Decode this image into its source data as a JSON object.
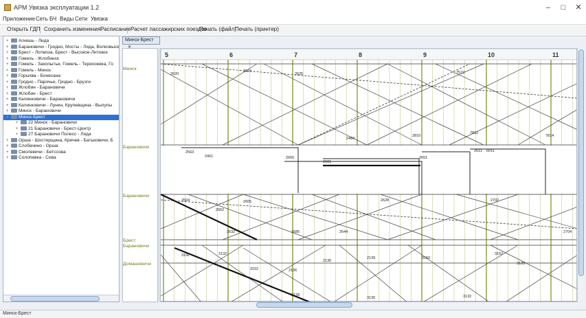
{
  "window": {
    "title": "АРМ Увязка эксплуатации 1.2",
    "minimize": "–",
    "maximize": "□",
    "close": "✕"
  },
  "menu": [
    "Приложение",
    "Сеть БЧ",
    "Виды",
    "Сети",
    "Увязка"
  ],
  "toolbar": [
    "Открыть ГДП",
    "Сохранить изменения",
    "Расписание",
    "Расчет пассажирских поездов",
    "Печать (файл)",
    "Печать (принтер)"
  ],
  "tree": [
    {
      "toggle": "+",
      "label": "Агнешь - Лида",
      "level": 0
    },
    {
      "toggle": "+",
      "label": "Барановичи - Гродно, Мосты - Лида, Волковыск",
      "level": 0
    },
    {
      "toggle": "+",
      "label": "Брест - Лотмоза, Брест - Высокое-Литовск",
      "level": 0
    },
    {
      "toggle": "+",
      "label": "Гомель - Жлобинск",
      "level": 0
    },
    {
      "toggle": "+",
      "label": "Гомель - Закопытье, Гомель - Терехоевка, Го",
      "level": 0
    },
    {
      "toggle": "+",
      "label": "Гомель - Минск",
      "level": 0
    },
    {
      "toggle": "+",
      "label": "Горыхва - Бонесана",
      "level": 0
    },
    {
      "toggle": "+",
      "label": "Гродно - Парочье, Гродно - Брузги",
      "level": 0
    },
    {
      "toggle": "+",
      "label": "Жлобин - Барановичи",
      "level": 0
    },
    {
      "toggle": "+",
      "label": "Жлобин - Брест",
      "level": 0
    },
    {
      "toggle": "+",
      "label": "Калинковичи - Барановичи",
      "level": 0
    },
    {
      "toggle": "+",
      "label": "Калинковичи - Лунин, Крупевщина - Вылупы",
      "level": 0
    },
    {
      "toggle": "+",
      "label": "Минск - Барановичи",
      "level": 0
    },
    {
      "toggle": "−",
      "label": "Минск-Брест",
      "level": 0,
      "selected": true
    },
    {
      "toggle": "+",
      "label": "22 Минск - Барановичи",
      "level": 1
    },
    {
      "toggle": "+",
      "label": "21 Барановичи - Брест-Центр",
      "level": 1
    },
    {
      "toggle": "+",
      "label": "27 Барановичи Полесс - Лида",
      "level": 1
    },
    {
      "toggle": "+",
      "label": "Орша - Шостерщина, Кричев - Батьковичи, Б",
      "level": 0
    },
    {
      "toggle": "+",
      "label": "Слобачино - Орша",
      "level": 0
    },
    {
      "toggle": "+",
      "label": "Смолевичи - Бетссова",
      "level": 0
    },
    {
      "toggle": "+",
      "label": "Солопевка - Сева",
      "level": 0
    }
  ],
  "tab": {
    "label": "Минск-Брест",
    "close": "✕"
  },
  "stations": [
    "Минск",
    "Барановичи",
    "Барановичи",
    "Брест",
    "Барановичи",
    "Домашевичи"
  ],
  "hours": [
    "5",
    "6",
    "7",
    "8",
    "9",
    "10",
    "11"
  ],
  "train_labels": [
    "2620",
    "2624",
    "2626",
    "7572",
    "2484",
    "2810",
    "7812",
    "7814",
    "2563",
    "2461",
    "2665",
    "2601",
    "2651",
    "2611",
    "6011",
    "2604",
    "2662",
    "2665",
    "2632",
    "2685",
    "2644",
    "2628",
    "2702",
    "2704",
    "3142",
    "2132",
    "3152",
    "2136",
    "2136",
    "2139",
    "3150",
    "3152",
    "3125",
    "3128",
    "3130",
    "3132"
  ],
  "status": "Минск-Брест",
  "colors": {
    "grid_hour": "#7a8a10",
    "grid_minor": "#c9d29a",
    "selected": "#2f6fd6",
    "station_label": "#6f7f1c"
  }
}
